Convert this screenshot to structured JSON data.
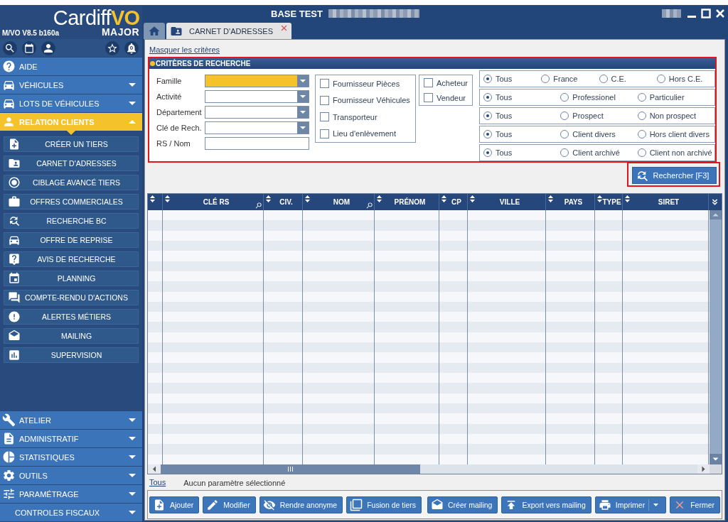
{
  "branding": {
    "name": "Cardiff",
    "name_accent": "VO",
    "edition": "MAJOR",
    "version": "M/VO V8.5 b160a",
    "notification_count": "0"
  },
  "sidebar": {
    "items": [
      {
        "label": "AIDE",
        "kind": "link"
      },
      {
        "label": "VÉHICULES",
        "kind": "group",
        "expanded": false
      },
      {
        "label": "LOTS DE VÉHICULES",
        "kind": "group",
        "expanded": false
      },
      {
        "label": "RELATION CLIENTS",
        "kind": "group",
        "expanded": true,
        "children": [
          {
            "label": "CRÉER UN TIERS"
          },
          {
            "label": "CARNET D'ADRESSES"
          },
          {
            "label": "CIBLAGE AVANCÉ TIERS"
          },
          {
            "label": "OFFRES COMMERCIALES"
          },
          {
            "label": "RECHERCHE BC"
          },
          {
            "label": "OFFRE DE REPRISE"
          },
          {
            "label": "AVIS DE RECHERCHE"
          },
          {
            "label": "PLANNING"
          },
          {
            "label": "COMPTE-RENDU D'ACTIONS"
          },
          {
            "label": "ALERTES MÉTIERS"
          },
          {
            "label": "MAILING"
          },
          {
            "label": "SUPERVISION"
          }
        ]
      },
      {
        "label": "ATELIER",
        "kind": "group",
        "expanded": false
      },
      {
        "label": "ADMINISTRATIF",
        "kind": "group",
        "expanded": false
      },
      {
        "label": "STATISTIQUES",
        "kind": "group",
        "expanded": false
      },
      {
        "label": "OUTILS",
        "kind": "group",
        "expanded": false
      },
      {
        "label": "PARAMÉTRAGE",
        "kind": "group",
        "expanded": false
      },
      {
        "label": "CONTROLES FISCAUX",
        "kind": "group",
        "expanded": false
      }
    ]
  },
  "window": {
    "title": "BASE TEST"
  },
  "tabs": [
    {
      "kind": "home",
      "selected": false
    },
    {
      "kind": "page",
      "label": "CARNET D'ADRESSES",
      "selected": true
    }
  ],
  "criteria": {
    "toggle_link": "Masquer les critères",
    "title": "CRITÈRES DE RECHERCHE",
    "highlighted": true,
    "fields": [
      {
        "label": "Famille",
        "kind": "select",
        "focused": true
      },
      {
        "label": "Activité",
        "kind": "select",
        "focused": false
      },
      {
        "label": "Département",
        "kind": "select",
        "focused": false
      },
      {
        "label": "Clé de Rech.",
        "kind": "select",
        "focused": false
      },
      {
        "label": "RS / Nom",
        "kind": "text",
        "focused": false
      }
    ],
    "checkbox_groups": [
      {
        "options": [
          {
            "label": "Fournisseur Pièces",
            "checked": false
          },
          {
            "label": "Fournisseur Véhicules",
            "checked": false
          },
          {
            "label": "Transporteur",
            "checked": false
          },
          {
            "label": "Lieu d'enlèvement",
            "checked": false
          }
        ]
      },
      {
        "options": [
          {
            "label": "Acheteur",
            "checked": false
          },
          {
            "label": "Vendeur",
            "checked": false
          }
        ]
      }
    ],
    "radio_groups": [
      {
        "options": [
          {
            "label": "Tous",
            "selected": true
          },
          {
            "label": "France",
            "selected": false
          },
          {
            "label": "C.E.",
            "selected": false
          },
          {
            "label": "Hors C.E.",
            "selected": false
          }
        ]
      },
      {
        "options": [
          {
            "label": "Tous",
            "selected": true
          },
          {
            "label": "Professionel",
            "selected": false
          },
          {
            "label": "Particulier",
            "selected": false
          }
        ]
      },
      {
        "options": [
          {
            "label": "Tous",
            "selected": true
          },
          {
            "label": "Prospect",
            "selected": false
          },
          {
            "label": "Non prospect",
            "selected": false
          }
        ]
      },
      {
        "options": [
          {
            "label": "Tous",
            "selected": true
          },
          {
            "label": "Client divers",
            "selected": false
          },
          {
            "label": "Hors client divers",
            "selected": false
          }
        ]
      },
      {
        "options": [
          {
            "label": "Tous",
            "selected": true
          },
          {
            "label": "Client archivé",
            "selected": false
          },
          {
            "label": "Client non archivé",
            "selected": false
          }
        ]
      }
    ]
  },
  "search_button": {
    "label": "Rechercher [F3]",
    "highlighted": true
  },
  "table": {
    "columns": [
      {
        "label": "CLÉ RS",
        "searchable": true
      },
      {
        "label": "CIV.",
        "searchable": false
      },
      {
        "label": "NOM",
        "searchable": true
      },
      {
        "label": "PRÉNOM",
        "searchable": false
      },
      {
        "label": "CP",
        "searchable": false
      },
      {
        "label": "VILLE",
        "searchable": false
      },
      {
        "label": "PAYS",
        "searchable": false
      },
      {
        "label": "TYPE",
        "searchable": false
      },
      {
        "label": "SIRET",
        "searchable": false
      }
    ]
  },
  "filter_bar": {
    "link": "Tous",
    "status": "Aucun paramètre sélectionné"
  },
  "action_groups": [
    {
      "buttons": [
        {
          "label": "Ajouter",
          "has_menu": false
        },
        {
          "label": "Modifier",
          "has_menu": false
        },
        {
          "label": "Rendre anonyme",
          "has_menu": false
        },
        {
          "label": "Fusion de tiers",
          "has_menu": false
        }
      ]
    },
    {
      "buttons": [
        {
          "label": "Créer mailing",
          "has_menu": false
        },
        {
          "label": "Export vers mailing",
          "has_menu": false
        },
        {
          "label": "Imprimer",
          "has_menu": true
        },
        {
          "label": "Fermer",
          "has_menu": false
        }
      ]
    }
  ]
}
